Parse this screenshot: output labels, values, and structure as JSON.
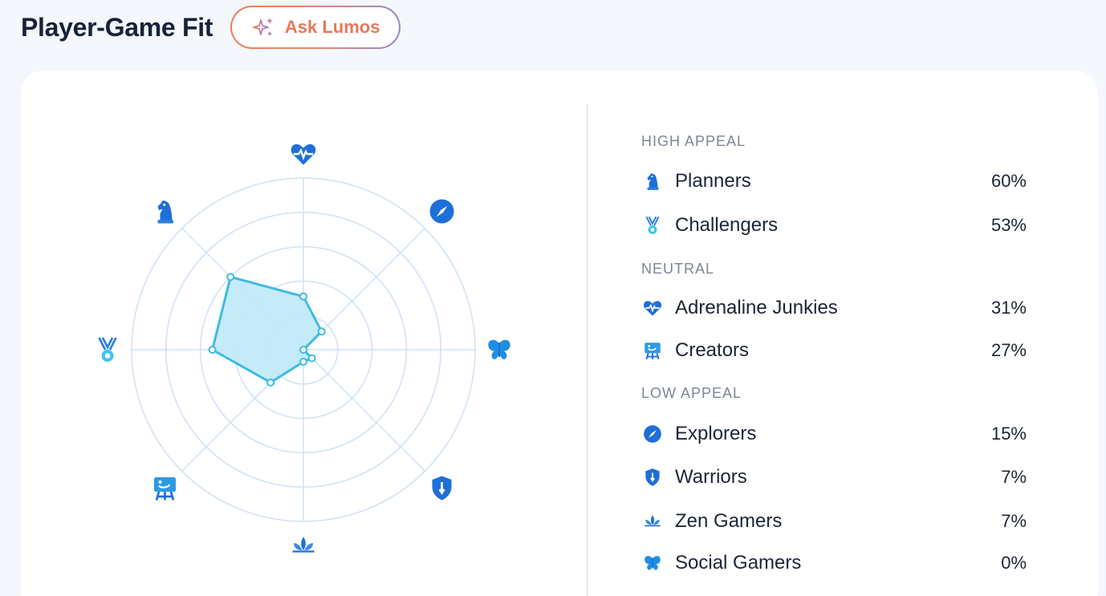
{
  "header": {
    "title": "Player-Game Fit",
    "ask_label": "Ask Lumos"
  },
  "colors": {
    "accent": "#e8785a",
    "radar_fill": "#bfe9f7",
    "radar_stroke": "#3dbbe3",
    "grid": "#cfe0f5",
    "icon_blue": "#1f6fd8"
  },
  "sections": [
    {
      "label": "HIGH APPEAL",
      "items": [
        {
          "name": "Planners",
          "pct": "60%",
          "icon": "chess-knight-icon"
        },
        {
          "name": "Challengers",
          "pct": "53%",
          "icon": "medal-icon"
        }
      ]
    },
    {
      "label": "NEUTRAL",
      "items": [
        {
          "name": "Adrenaline Junkies",
          "pct": "31%",
          "icon": "heartbeat-icon"
        },
        {
          "name": "Creators",
          "pct": "27%",
          "icon": "easel-icon"
        }
      ]
    },
    {
      "label": "LOW APPEAL",
      "items": [
        {
          "name": "Explorers",
          "pct": "15%",
          "icon": "compass-icon"
        },
        {
          "name": "Warriors",
          "pct": "7%",
          "icon": "shield-icon"
        },
        {
          "name": "Zen Gamers",
          "pct": "7%",
          "icon": "lotus-icon"
        },
        {
          "name": "Social Gamers",
          "pct": "0%",
          "icon": "butterfly-icon"
        }
      ]
    }
  ],
  "chart_data": {
    "type": "radar",
    "axes": [
      "Adrenaline Junkies",
      "Explorers",
      "Social Gamers",
      "Warriors",
      "Zen Gamers",
      "Creators",
      "Challengers",
      "Planners"
    ],
    "values": [
      31,
      15,
      0,
      7,
      7,
      27,
      53,
      60
    ],
    "range": [
      0,
      100
    ],
    "rings": 5
  }
}
